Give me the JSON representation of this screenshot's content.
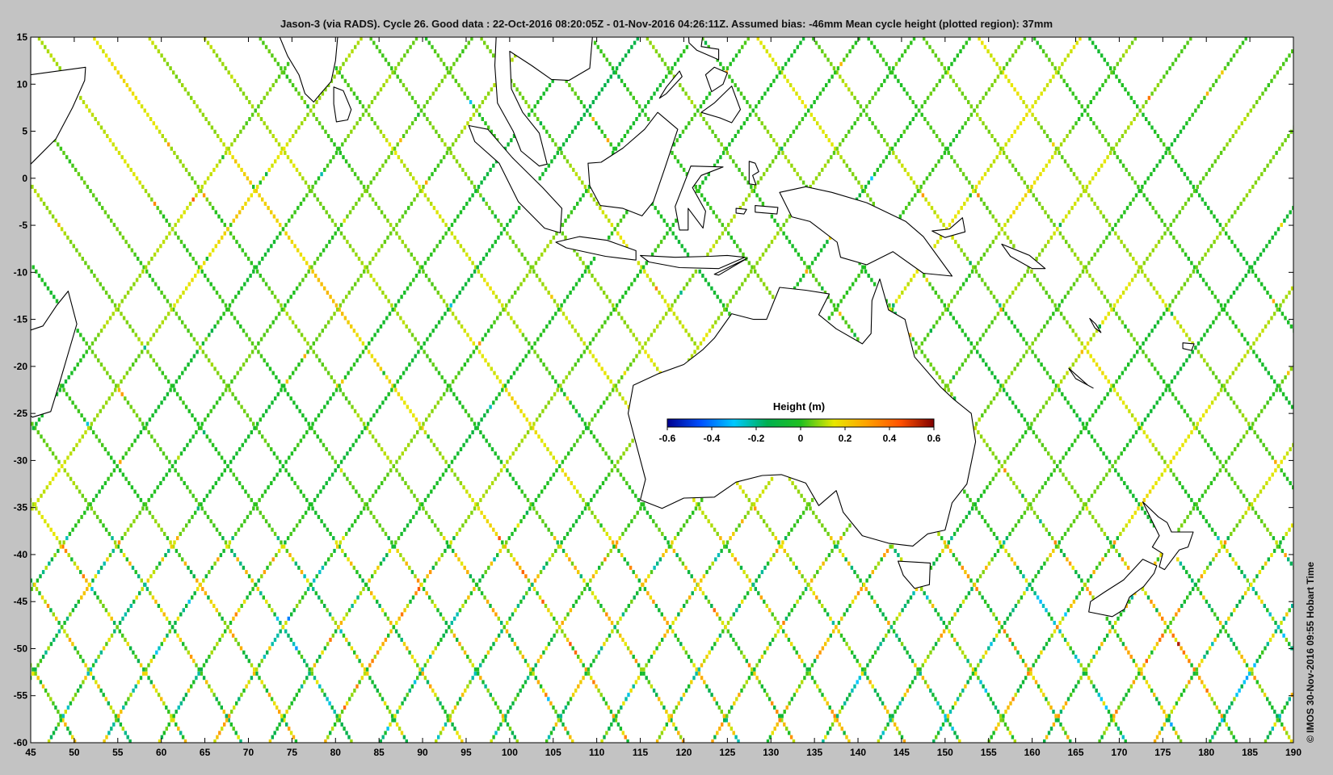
{
  "title": "Jason-3 (via RADS). Cycle 26. Good data : 22-Oct-2016 08:20:05Z - 01-Nov-2016 04:26:11Z. Assumed bias: -46mm  Mean cycle height (plotted region): 37mm",
  "credit": "©  IMOS 30-Nov-2016 09:55 Hobart Time",
  "colorbar": {
    "label": "Height (m)",
    "ticks": [
      "-0.6",
      "-0.4",
      "-0.2",
      "0",
      "0.2",
      "0.4",
      "0.6"
    ],
    "range": [
      -0.6,
      0.6
    ],
    "colormap": [
      "#00008f",
      "#0050ff",
      "#00c8ff",
      "#00b050",
      "#20c020",
      "#e8e800",
      "#ffa000",
      "#ff5000",
      "#800000"
    ]
  },
  "chart_data": {
    "type": "map",
    "xlim": [
      45,
      190
    ],
    "ylim": [
      -60,
      15
    ],
    "xticks": [
      "45",
      "50",
      "55",
      "60",
      "65",
      "70",
      "75",
      "80",
      "85",
      "90",
      "95",
      "100",
      "105",
      "110",
      "115",
      "120",
      "125",
      "130",
      "135",
      "140",
      "145",
      "150",
      "155",
      "160",
      "165",
      "170",
      "175",
      "180",
      "185",
      "190"
    ],
    "yticks": [
      "15",
      "10",
      "5",
      "0",
      "-5",
      "-10",
      "-15",
      "-20",
      "-25",
      "-30",
      "-35",
      "-40",
      "-45",
      "-50",
      "-55",
      "-60"
    ],
    "grid": false,
    "background": "#ffffff",
    "land_fill": "#ffffff",
    "coast_color": "#000000"
  }
}
